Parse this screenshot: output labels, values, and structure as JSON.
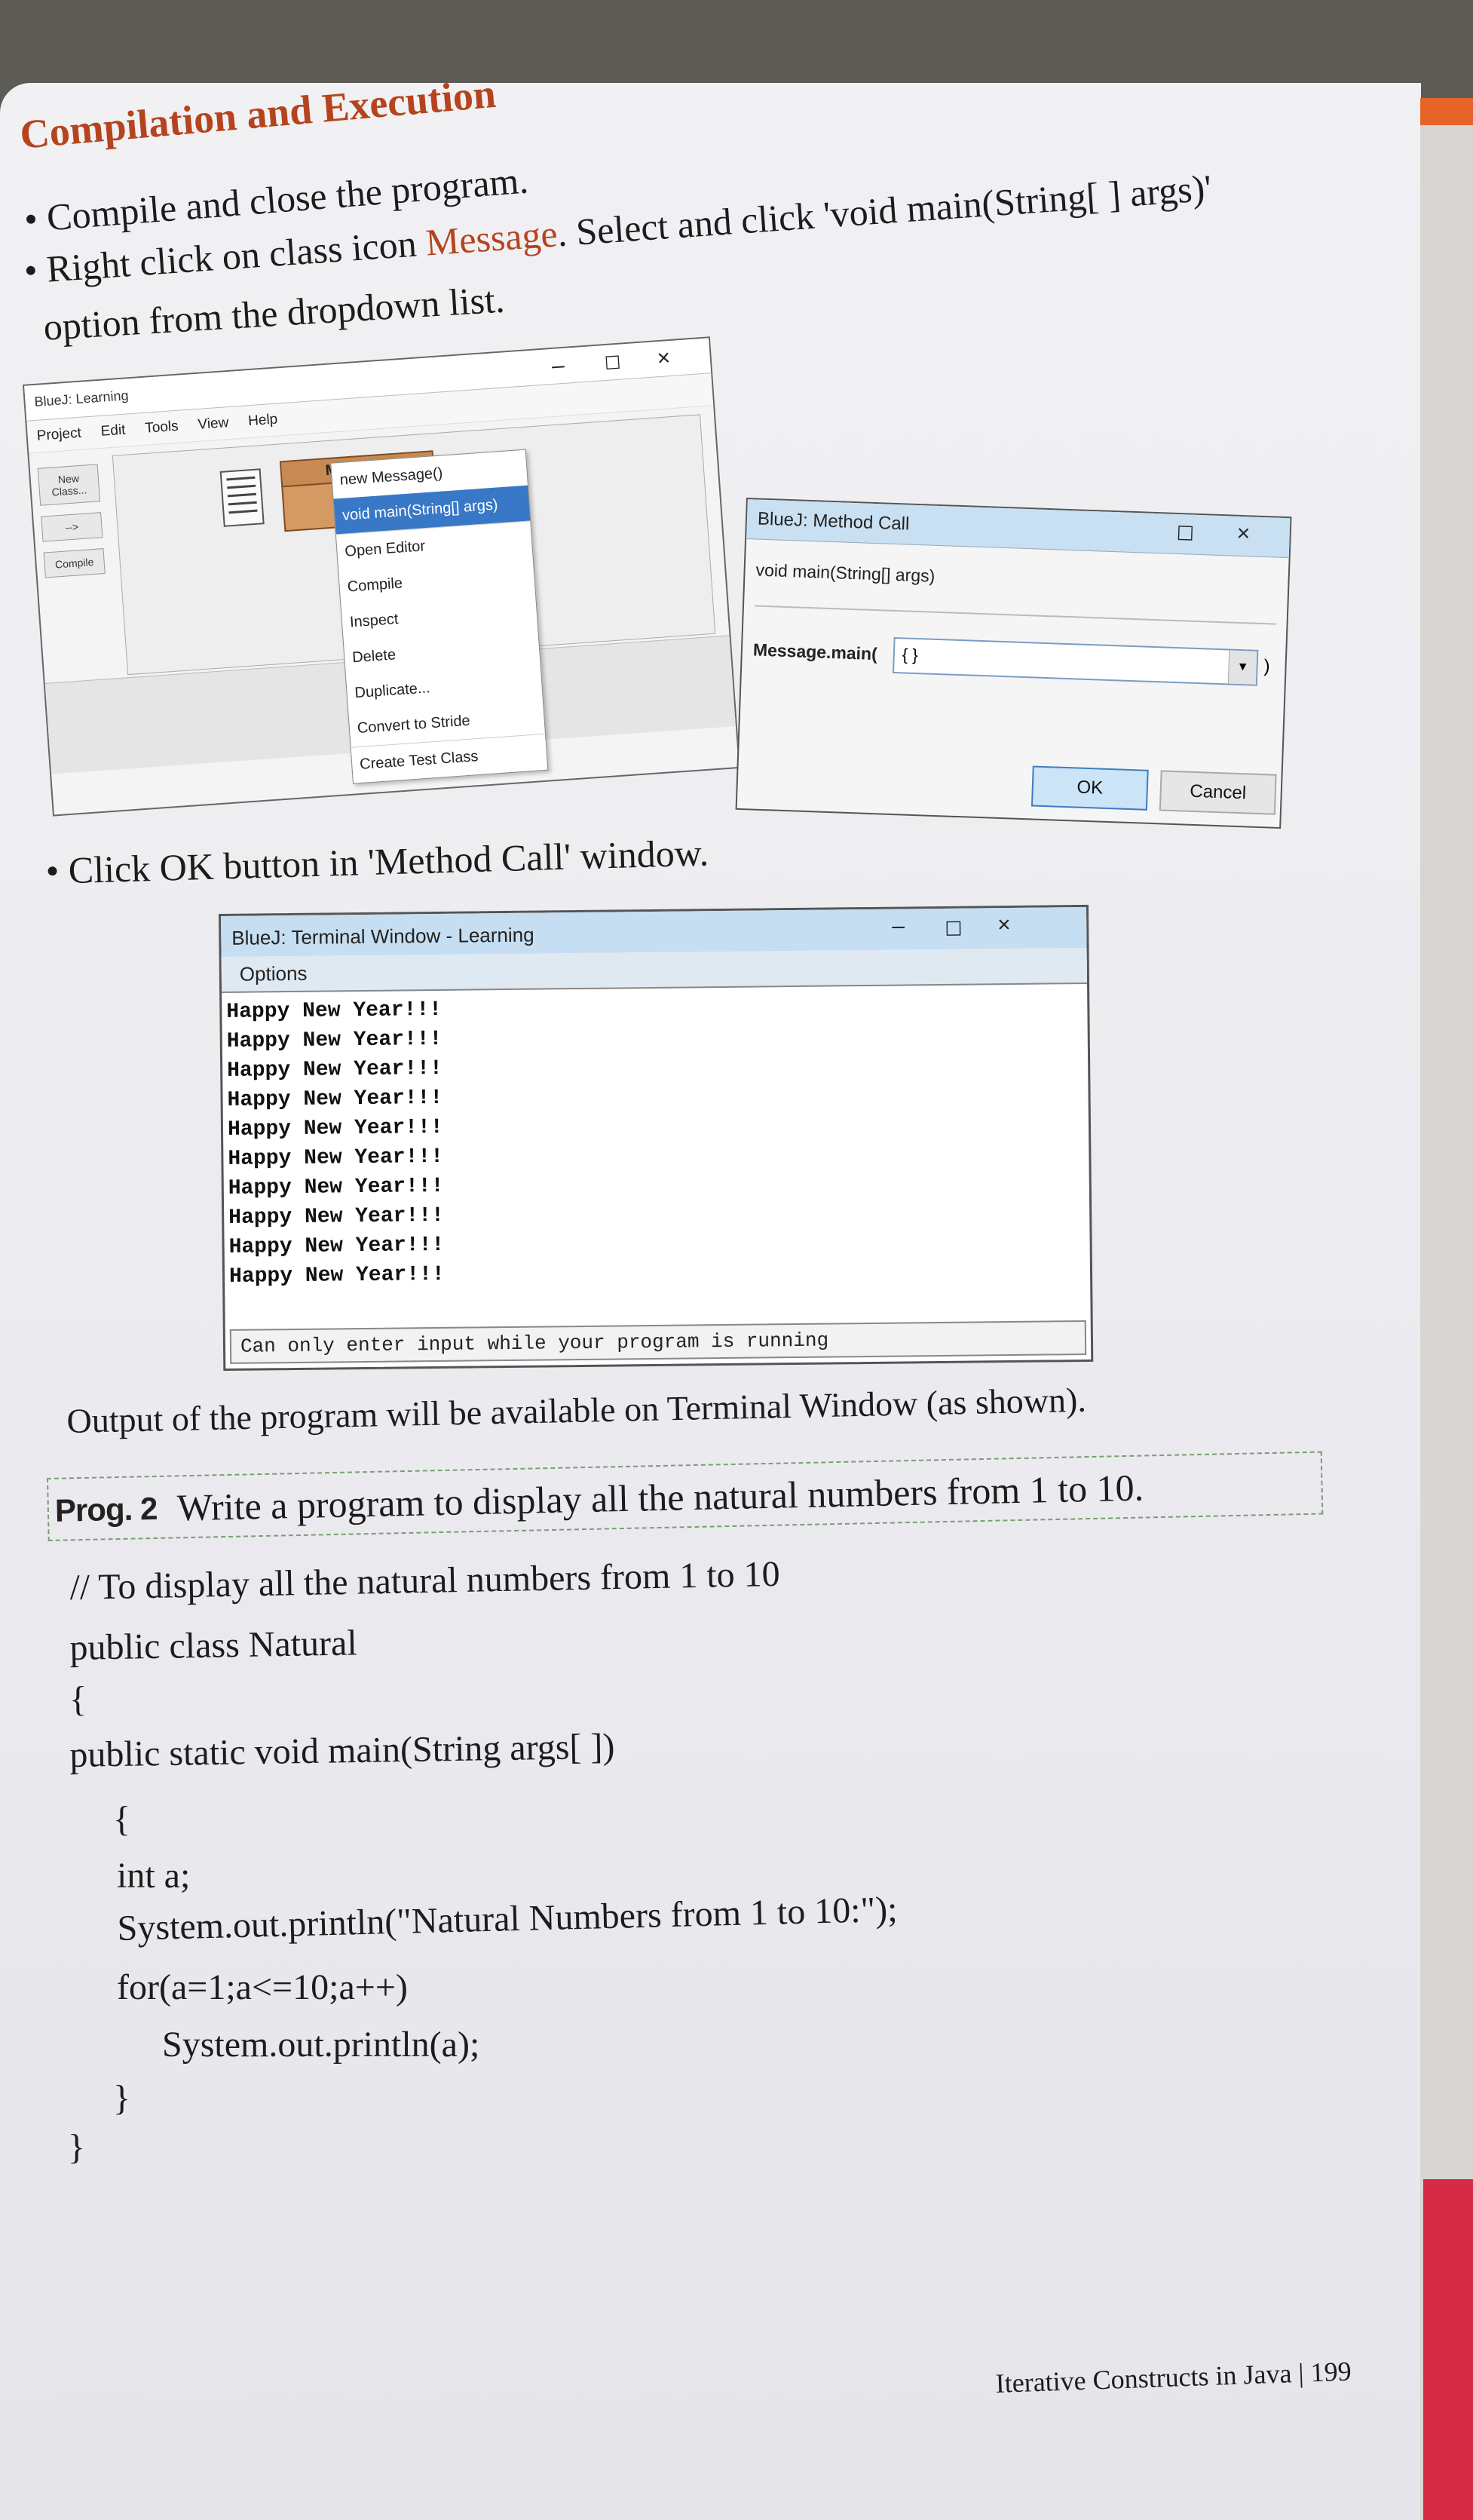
{
  "section_heading": "Compilation and Execution",
  "instructions": {
    "step1": "Compile and close the program.",
    "step2_prefix": "Right click on class icon",
    "step2_highlight": "Message",
    "step2_suffix": ". Select and click 'void main(String[ ] args)'",
    "step2_cont": "option from the dropdown list.",
    "step3": "Click OK button in 'Method Call' window."
  },
  "bluej_main": {
    "title": "BlueJ: Learning",
    "menu": [
      "Project",
      "Edit",
      "Tools",
      "View",
      "Help"
    ],
    "side_buttons": [
      "New Class...",
      "-->",
      "Compile"
    ],
    "class_name": "Message",
    "context_menu": [
      "new Message()",
      "void main(String[] args)",
      "Open Editor",
      "Compile",
      "Inspect",
      "Delete",
      "Duplicate...",
      "Convert to Stride",
      "Create Test Class"
    ]
  },
  "method_call": {
    "title": "BlueJ: Method Call",
    "signature": "void main(String[] args)",
    "call_label": "Message.main(",
    "arg_value": "{ }",
    "close_paren": ")",
    "ok": "OK",
    "cancel": "Cancel"
  },
  "terminal": {
    "title": "BlueJ: Terminal Window - Learning",
    "menu": "Options",
    "lines": [
      "Happy New Year!!!",
      "Happy New Year!!!",
      "Happy New Year!!!",
      "Happy New Year!!!",
      "Happy New Year!!!",
      "Happy New Year!!!",
      "Happy New Year!!!",
      "Happy New Year!!!",
      "Happy New Year!!!",
      "Happy New Year!!!"
    ],
    "status": "Can only enter input while your program is running"
  },
  "output_note": "Output of the program will be available on Terminal Window (as shown).",
  "program": {
    "label": "Prog. 2",
    "task": "Write a program to display all the natural numbers from 1 to 10."
  },
  "code_lines": [
    "// To display all the natural numbers from 1 to 10",
    "public class Natural",
    "{",
    "public static void main(String args[ ])",
    "{",
    "int a;",
    "System.out.println(\"Natural Numbers from 1 to 10:\");",
    "for(a=1;a<=10;a++)",
    "System.out.println(a);",
    "}",
    "}"
  ],
  "footer": "Iterative Constructs in Java | 199"
}
